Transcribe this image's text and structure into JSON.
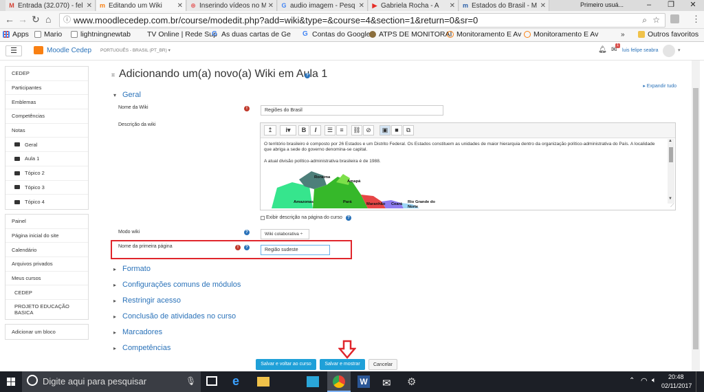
{
  "browser": {
    "tabs": [
      {
        "label": "Entrada (32.070) - fel",
        "icon": "gmail-icon",
        "color": "#d23f31"
      },
      {
        "label": "Editando um Wiki",
        "icon": "moodle-icon",
        "color": "#f98012"
      },
      {
        "label": "Inserindo vídeos no M",
        "icon": "doc-icon",
        "color": "#e57373"
      },
      {
        "label": "audio imagem - Pesq",
        "icon": "google-icon",
        "color": "#4285f4"
      },
      {
        "label": "Gabriela Rocha - A",
        "icon": "youtube-icon",
        "color": "#e52d27"
      },
      {
        "label": "Estados do Brasil - M",
        "icon": "moodle-icon",
        "color": "#2a5fa8"
      }
    ],
    "profile_label": "Primeiro usuá...",
    "url": "www.moodlecedep.com.br/course/modedit.php?add=wiki&type=&course=4&section=1&return=0&sr=0",
    "bookmarks": [
      {
        "label": "Apps"
      },
      {
        "label": "Mario"
      },
      {
        "label": "lightningnewtab"
      },
      {
        "label": "TV Online | Rede Sup"
      },
      {
        "label": "As duas cartas de Ge"
      },
      {
        "label": "Contas do Google"
      },
      {
        "label": "ATPS DE MONITORAI"
      },
      {
        "label": "Monitoramento E Av"
      },
      {
        "label": "Monitoramento E Av"
      },
      {
        "label": "Outros favoritos"
      }
    ]
  },
  "moodle": {
    "site_name": "Moodle Cedep",
    "language": "PORTUGUÊS - BRASIL (PT_BR) ▾",
    "user_name": "luis felipe seabra",
    "notification_count": "1"
  },
  "nav": {
    "block1": [
      "CEDEP",
      "Participantes",
      "Emblemas",
      "Competências",
      "Notas"
    ],
    "topics": [
      "Geral",
      "Aula 1",
      "Tópico 2",
      "Tópico 3",
      "Tópico 4"
    ],
    "block2": [
      "Painel",
      "Página inicial do site",
      "Calendário",
      "Arquivos privados",
      "Meus cursos"
    ],
    "courses": [
      "CEDEP",
      "PROJETO EDUCAÇÃO BASICA"
    ],
    "add_block": "Adicionar um bloco"
  },
  "page": {
    "title": "Adicionando um(a) novo(a) Wiki em Aula 1",
    "expand_all": "Expandir tudo",
    "section_general": "Geral",
    "wiki_name_label": "Nome da Wiki",
    "wiki_name_value": "Regiões do Brasil",
    "description_label": "Descrição da wiki",
    "editor_text_1": "O território brasileiro é composto por 26 Estados e um Distrito Federal. Os Estados constituem as unidades de maior hierarquia dentro da organização político-administrativa do País. A localidade que abriga a sede do governo denomina-se capital.",
    "editor_text_2": "A atual divisão político-administrativa brasileira é de 1988.",
    "map_labels": [
      "Roraima",
      "Amapá",
      "Amazonas",
      "Pará",
      "Maranhão",
      "Ceará",
      "Rio Grande do Norte"
    ],
    "show_description_label": "Exibir descrição na página do curso",
    "wiki_mode_label": "Modo wiki",
    "wiki_mode_value": "Wiki colaborativa ÷",
    "first_page_label": "Nome da primeira página",
    "first_page_value": "Região sudeste",
    "collapsed_sections": [
      "Formato",
      "Configurações comuns de módulos",
      "Restringir acesso",
      "Conclusão de atividades no curso",
      "Marcadores",
      "Competências"
    ],
    "btn_save_return": "Salvar e voltar ao curso",
    "btn_save_show": "Salvar e mostrar",
    "btn_cancel": "Cancelar"
  },
  "taskbar": {
    "search_placeholder": "Digite aqui para pesquisar",
    "time": "20:48",
    "date": "02/11/2017"
  },
  "colors": {
    "moodle_blue": "#2a72b9",
    "button_blue": "#1fa0d8",
    "required_red": "#c0392b",
    "highlight_red": "#e0252b",
    "taskbar": "#1c1f26"
  }
}
